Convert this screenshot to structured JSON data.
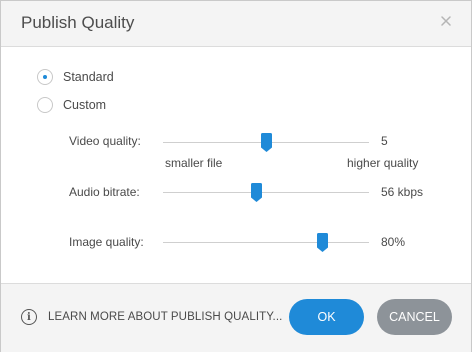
{
  "dialog": {
    "title": "Publish Quality",
    "close_icon": "close-icon"
  },
  "mode": {
    "options": [
      {
        "label": "Standard",
        "selected": true
      },
      {
        "label": "Custom",
        "selected": false
      }
    ]
  },
  "settings": {
    "video": {
      "label": "Video quality:",
      "value": "5",
      "level": 0.5,
      "min_label": "smaller file",
      "max_label": "higher quality"
    },
    "audio": {
      "label": "Audio bitrate:",
      "value": "56 kbps",
      "level": 0.45
    },
    "image": {
      "label": "Image quality:",
      "value": "80%",
      "level": 0.77
    }
  },
  "footer": {
    "learn_more": "LEARN MORE ABOUT PUBLISH QUALITY...",
    "info_icon": "info-icon",
    "ok_label": "OK",
    "cancel_label": "CANCEL"
  },
  "colors": {
    "accent": "#1f8ad8",
    "cancel": "#8d9399"
  }
}
